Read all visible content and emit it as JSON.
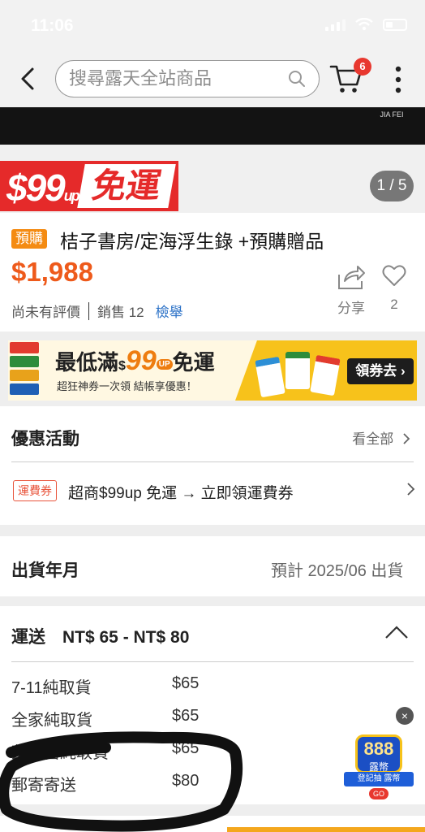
{
  "status_bar": {
    "time": "11:06"
  },
  "header": {
    "search_placeholder": "搜尋露天全站商品",
    "cart_count": "6"
  },
  "gallery": {
    "brand_watermark": "JIA FEI",
    "promo_price": "$99",
    "promo_unit": "up",
    "promo_free": "免運",
    "page_indicator": "1 / 5"
  },
  "product": {
    "tag": "預購",
    "title": "桔子書房/定海浮生錄 +預購贈品",
    "price": "$1,988",
    "rating_text": "尚未有評價",
    "sales_text": "銷售 12",
    "report_text": "檢舉",
    "share_label": "分享",
    "like_count": "2"
  },
  "coupon_banner": {
    "title_prefix": "最低滿",
    "title_currency": "$",
    "title_amount": "99",
    "title_up": "UP",
    "title_suffix": "免運",
    "subtitle": "超狂神券一次領 結帳享優惠！",
    "button_label": "領券去 ›"
  },
  "promotions": {
    "title": "優惠活動",
    "view_all": "看全部",
    "item_tag": "運費券",
    "item_text": "超商$99up 免運 → 立即領運費券"
  },
  "ship_date": {
    "label": "出貨年月",
    "value": "預計 2025/06 出貨"
  },
  "shipping": {
    "title": "運送　NT$ 65 - NT$ 80",
    "options": [
      {
        "method": "7-11純取貨",
        "price": "$65"
      },
      {
        "method": "全家純取貨",
        "price": "$65"
      },
      {
        "method": "萊爾富純取貨",
        "price": "$65"
      },
      {
        "method": "郵寄寄送",
        "price": "$80"
      }
    ]
  },
  "floating_promo": {
    "number": "888",
    "unit": "露幣",
    "ribbon": "登記抽 露幣",
    "go": "GO",
    "close": "×"
  },
  "colors": {
    "price": "#ee5a1b",
    "promo_red": "#e52a2a",
    "link_blue": "#2c72c7",
    "preorder_orange": "#f48b12"
  }
}
